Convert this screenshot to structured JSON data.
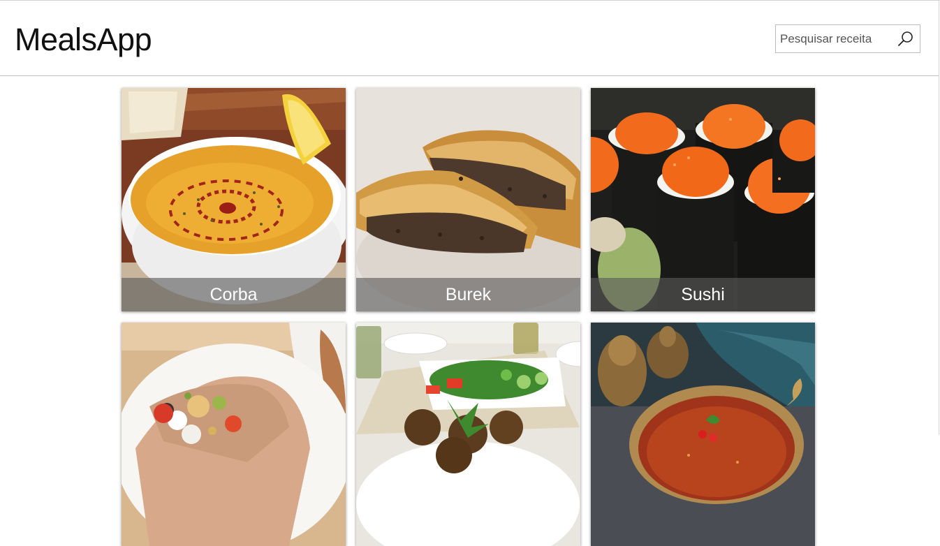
{
  "header": {
    "brand": "MealsApp",
    "search_placeholder": "Pesquisar receita",
    "search_icon": "search-icon"
  },
  "meals": [
    {
      "name": "Corba"
    },
    {
      "name": "Burek"
    },
    {
      "name": "Sushi"
    },
    {
      "name": ""
    },
    {
      "name": ""
    },
    {
      "name": ""
    }
  ]
}
